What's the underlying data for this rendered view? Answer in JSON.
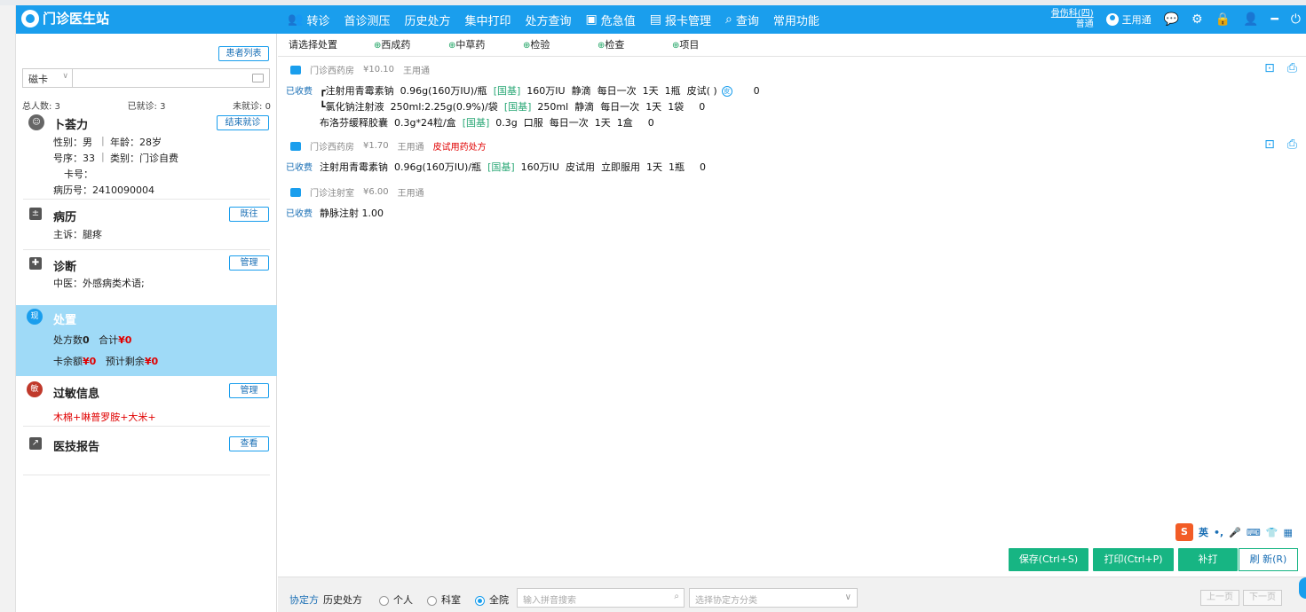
{
  "app": {
    "title": "门诊医生站"
  },
  "nav": [
    {
      "icon": "transfer-icon",
      "label": "转诊"
    },
    {
      "icon": "",
      "label": "首诊测压"
    },
    {
      "icon": "",
      "label": "历史处方"
    },
    {
      "icon": "",
      "label": "集中打印"
    },
    {
      "icon": "",
      "label": "处方查询"
    },
    {
      "icon": "critical-value-icon",
      "label": "危急值"
    },
    {
      "icon": "report-card-icon",
      "label": "报卡管理"
    },
    {
      "icon": "query-icon",
      "label": "查询"
    },
    {
      "icon": "",
      "label": "常用功能"
    }
  ],
  "top_right": {
    "dept": "骨伤科(四)",
    "dept_type": "普通",
    "user": "王用通"
  },
  "left": {
    "patient_list": "患者列表",
    "card_type": "磁卡",
    "stats": {
      "total": "总人数: 3",
      "seen": "已就诊: 3",
      "unseen": "未就诊: 0"
    },
    "patient": {
      "name": "卜荟力",
      "end_button": "结束就诊",
      "gender": "性别：男",
      "age": "年龄：28岁",
      "seq": "号序：33",
      "category": "类别：门诊自费",
      "card_no": "卡号：",
      "record_no": "病历号：2410090004"
    },
    "history": {
      "title": "病历",
      "button": "既往",
      "complaint": "主诉：腿疼"
    },
    "diagnosis": {
      "title": "诊断",
      "button": "管理",
      "text": "中医：外感病类术语;"
    },
    "dispose": {
      "badge": "现",
      "title": "处置",
      "rx_count_label": "处方数",
      "rx_count": "0",
      "total_label": "合计",
      "total": "¥0",
      "balance_label": "卡余额",
      "balance": "¥0",
      "remain_label": "预计剩余",
      "remain": "¥0"
    },
    "allergy": {
      "badge": "敏",
      "title": "过敏信息",
      "button": "管理",
      "text": "木棉+啉普罗胺+大米+"
    },
    "report": {
      "title": "医技报告",
      "button": "查看"
    }
  },
  "tabs": [
    "请选择处置",
    "西成药",
    "中草药",
    "检验",
    "检查",
    "项目"
  ],
  "prescriptions": [
    {
      "pharmacy": "门诊西药房",
      "amount": "¥10.10",
      "doctor": "王用通",
      "note": "",
      "status": "已收费",
      "lines": [
        {
          "prefix": "┏",
          "name": "注射用青霉素钠",
          "spec": "0.96g(160万IU)/瓶",
          "tag": "[国基]",
          "dose": "160万IU",
          "route": "静滴",
          "freq": "每日一次",
          "days": "1天",
          "qty": "1瓶",
          "extra": "皮试( )",
          "num": "0"
        },
        {
          "prefix": "┗",
          "name": "氯化钠注射液",
          "spec": "250ml:2.25g(0.9%)/袋",
          "tag": "[国基]",
          "dose": "250ml",
          "route": "静滴",
          "freq": "每日一次",
          "days": "1天",
          "qty": "1袋",
          "extra": "",
          "num": "0"
        },
        {
          "prefix": "",
          "name": "布洛芬缓释胶囊",
          "spec": "0.3g*24粒/盒",
          "tag": "[国基]",
          "dose": "0.3g",
          "route": "口服",
          "freq": "每日一次",
          "days": "1天",
          "qty": "1盒",
          "extra": "",
          "num": "0"
        }
      ]
    },
    {
      "pharmacy": "门诊西药房",
      "amount": "¥1.70",
      "doctor": "王用通",
      "note": "皮试用药处方",
      "status": "已收费",
      "lines": [
        {
          "prefix": "",
          "name": "注射用青霉素钠",
          "spec": "0.96g(160万IU)/瓶",
          "tag": "[国基]",
          "dose": "160万IU",
          "route": "皮试用",
          "freq": "立即服用",
          "days": "1天",
          "qty": "1瓶",
          "extra": "",
          "num": "0"
        }
      ]
    },
    {
      "pharmacy": "门诊注射室",
      "amount": "¥6.00",
      "doctor": "王用通",
      "note": "",
      "status": "已收费",
      "lines": [
        {
          "text": "静脉注射 1.00"
        }
      ]
    }
  ],
  "buttons": {
    "save": "保存(Ctrl+S)",
    "print": "打印(Ctrl+P)",
    "reprint": "补打",
    "refresh": "刷 新(R)"
  },
  "bottom": {
    "label1": "协定方",
    "label2": "历史处方",
    "radio_personal": "个人",
    "radio_dept": "科室",
    "radio_all": "全院",
    "search_placeholder": "输入拼音搜索",
    "category_placeholder": "选择协定方分类",
    "prev": "上一页",
    "next": "下一页"
  },
  "ime": {
    "logo": "S",
    "lang": "英"
  },
  "colors": {
    "topbar": "#1a9eed",
    "dispose_bg": "#9fdaf7",
    "action_green": "#17b583",
    "price_red": "#e00000"
  }
}
